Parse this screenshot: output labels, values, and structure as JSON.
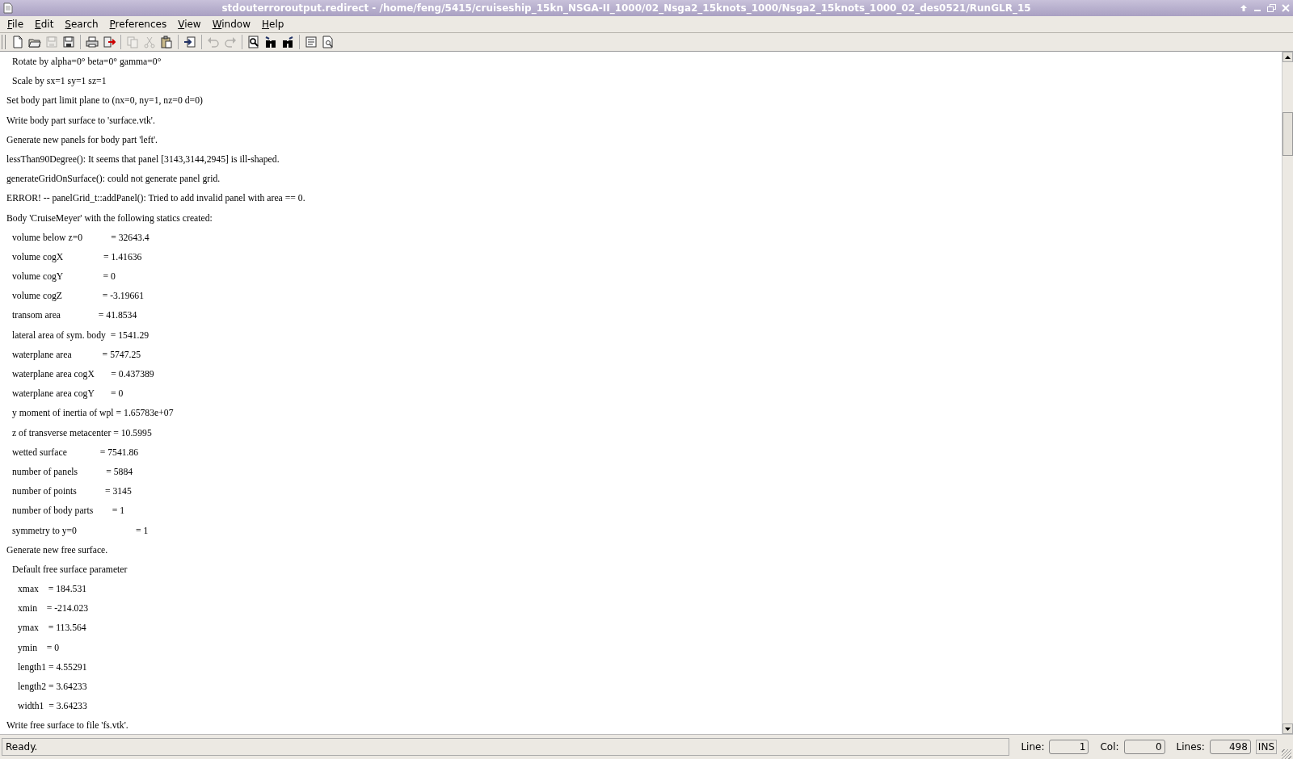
{
  "window": {
    "title": "stdouterroroutput.redirect - /home/feng/5415/cruiseship_15kn_NSGA-II_1000/02_Nsga2_15knots_1000/Nsga2_15knots_1000_02_des0521/RunGLR_15"
  },
  "menu": [
    "File",
    "Edit",
    "Search",
    "Preferences",
    "View",
    "Window",
    "Help"
  ],
  "toolbar": [
    [
      {
        "kind": "new",
        "disabled": false
      },
      {
        "kind": "open",
        "disabled": false
      },
      {
        "kind": "save",
        "disabled": true
      },
      {
        "kind": "saveas",
        "disabled": false
      }
    ],
    [
      {
        "kind": "print",
        "disabled": false
      },
      {
        "kind": "exit",
        "disabled": false
      }
    ],
    [
      {
        "kind": "copy",
        "disabled": true
      },
      {
        "kind": "cut",
        "disabled": true
      },
      {
        "kind": "paste",
        "disabled": false
      }
    ],
    [
      {
        "kind": "import",
        "disabled": false
      }
    ],
    [
      {
        "kind": "undo",
        "disabled": true
      },
      {
        "kind": "redo",
        "disabled": true
      }
    ],
    [
      {
        "kind": "find",
        "disabled": false
      },
      {
        "kind": "findprev",
        "disabled": false
      },
      {
        "kind": "findnext",
        "disabled": false
      }
    ],
    [
      {
        "kind": "doc",
        "disabled": false
      },
      {
        "kind": "docsearch",
        "disabled": false
      }
    ]
  ],
  "log": [
    {
      "children": [
        {
          "text": "Rotate by alpha=0° beta=0° gamma=0°"
        },
        {
          "text": "Scale by sx=1 sy=1 sz=1"
        }
      ]
    },
    {
      "text": "Set body part limit plane to (nx=0, ny=1, nz=0 d=0)"
    },
    {
      "text": "Write body part surface to 'surface.vtk'."
    },
    {
      "text": "Generate new panels for body part 'left'."
    },
    {
      "text": "lessThan90Degree(): It seems that panel [3143,3144,2945] is ill-shaped."
    },
    {
      "text": "generateGridOnSurface(): could not generate panel grid."
    },
    {
      "text": "ERROR! -- panelGrid_t::addPanel(): Tried to add invalid panel with area == 0."
    },
    {
      "text": "Body 'CruiseMeyer' with the following statics created:",
      "children": [
        {
          "text": "volume below z=0            = 32643.4"
        },
        {
          "text": "volume cogX                 = 1.41636"
        },
        {
          "text": "volume cogY                 = 0"
        },
        {
          "text": "volume cogZ                 = -3.19661"
        },
        {
          "text": "transom area                = 41.8534"
        },
        {
          "text": "lateral area of sym. body  = 1541.29"
        },
        {
          "text": "waterplane area             = 5747.25"
        },
        {
          "text": "waterplane area cogX       = 0.437389"
        },
        {
          "text": "waterplane area cogY       = 0"
        },
        {
          "text": "y moment of inertia of wpl = 1.65783e+07"
        },
        {
          "text": "z of transverse metacenter = 10.5995"
        },
        {
          "text": "wetted surface              = 7541.86"
        },
        {
          "text": "number of panels            = 5884"
        },
        {
          "text": "number of points            = 3145"
        },
        {
          "text": "number of body parts        = 1"
        },
        {
          "text": "symmetry to y=0                         = 1"
        }
      ]
    },
    {
      "text": "Generate new free surface.",
      "children": [
        {
          "text": "Default free surface parameter",
          "children": [
            {
              "text": "xmax    = 184.531"
            },
            {
              "text": "xmin    = -214.023"
            },
            {
              "text": "ymax    = 113.564"
            },
            {
              "text": "ymin    = 0"
            },
            {
              "text": "length1 = 4.55291"
            },
            {
              "text": "length2 = 3.64233"
            },
            {
              "text": "width1  = 3.64233"
            }
          ]
        }
      ]
    },
    {
      "text": "Write free surface to file 'fs.vtk'."
    }
  ],
  "status": {
    "message": "Ready.",
    "line_label": "Line:",
    "line": "1",
    "col_label": "Col:",
    "col": "0",
    "lines_label": "Lines:",
    "lines": "498",
    "mode": "INS"
  }
}
